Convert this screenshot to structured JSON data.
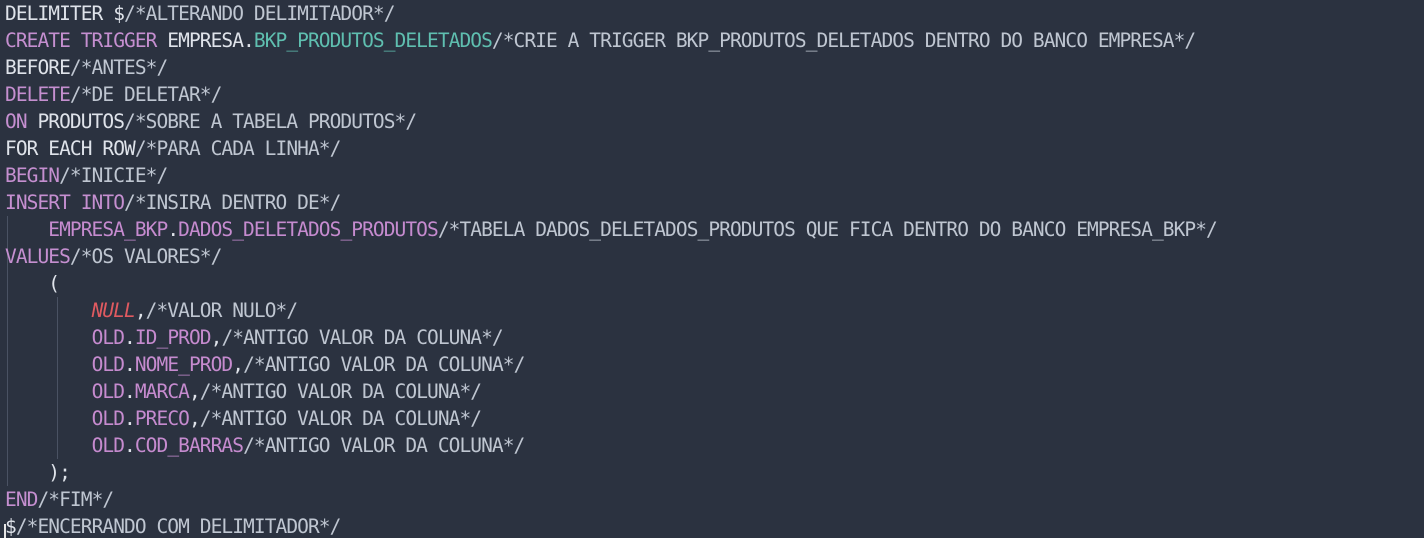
{
  "editor": {
    "colors": {
      "background": "#2b3240",
      "plain": "#dfe3ea",
      "keyword": "#c58fd0",
      "comment": "#bfc6d1",
      "identifier": "#c68bcf",
      "function": "#5fbfb0",
      "null": "#e05a60"
    },
    "lines": [
      [
        {
          "t": "plain",
          "v": "DELIMITER $"
        },
        {
          "t": "comment",
          "v": "/*ALTERANDO DELIMITADOR*/"
        }
      ],
      [
        {
          "t": "keyword",
          "v": "CREATE TRIGGER"
        },
        {
          "t": "plain",
          "v": " EMPRESA."
        },
        {
          "t": "func",
          "v": "BKP_PRODUTOS_DELETADOS"
        },
        {
          "t": "comment",
          "v": "/*CRIE A TRIGGER BKP_PRODUTOS_DELETADOS DENTRO DO BANCO EMPRESA*/"
        }
      ],
      [
        {
          "t": "plain",
          "v": "BEFORE"
        },
        {
          "t": "comment",
          "v": "/*ANTES*/"
        }
      ],
      [
        {
          "t": "keyword",
          "v": "DELETE"
        },
        {
          "t": "comment",
          "v": "/*DE DELETAR*/"
        }
      ],
      [
        {
          "t": "keyword",
          "v": "ON"
        },
        {
          "t": "plain",
          "v": " PRODUTOS"
        },
        {
          "t": "comment",
          "v": "/*SOBRE A TABELA PRODUTOS*/"
        }
      ],
      [
        {
          "t": "plain",
          "v": "FOR EACH ROW"
        },
        {
          "t": "comment",
          "v": "/*PARA CADA LINHA*/"
        }
      ],
      [
        {
          "t": "keyword",
          "v": "BEGIN"
        },
        {
          "t": "comment",
          "v": "/*INICIE*/"
        }
      ],
      [
        {
          "t": "keyword",
          "v": "INSERT INTO"
        },
        {
          "t": "comment",
          "v": "/*INSIRA DENTRO DE*/"
        }
      ],
      [
        {
          "t": "plain",
          "v": "    "
        },
        {
          "t": "ident",
          "v": "EMPRESA_BKP"
        },
        {
          "t": "plain",
          "v": "."
        },
        {
          "t": "ident",
          "v": "DADOS_DELETADOS_PRODUTOS"
        },
        {
          "t": "comment",
          "v": "/*TABELA DADOS_DELETADOS_PRODUTOS QUE FICA DENTRO DO BANCO EMPRESA_BKP*/"
        }
      ],
      [
        {
          "t": "keyword",
          "v": "VALUES"
        },
        {
          "t": "comment",
          "v": "/*OS VALORES*/"
        }
      ],
      [
        {
          "t": "plain",
          "v": "    ("
        }
      ],
      [
        {
          "t": "plain",
          "v": "        "
        },
        {
          "t": "null",
          "v": "NULL"
        },
        {
          "t": "plain",
          "v": ","
        },
        {
          "t": "comment",
          "v": "/*VALOR NULO*/"
        }
      ],
      [
        {
          "t": "plain",
          "v": "        "
        },
        {
          "t": "ident",
          "v": "OLD"
        },
        {
          "t": "plain",
          "v": "."
        },
        {
          "t": "ident",
          "v": "ID_PROD"
        },
        {
          "t": "plain",
          "v": ","
        },
        {
          "t": "comment",
          "v": "/*ANTIGO VALOR DA COLUNA*/"
        }
      ],
      [
        {
          "t": "plain",
          "v": "        "
        },
        {
          "t": "ident",
          "v": "OLD"
        },
        {
          "t": "plain",
          "v": "."
        },
        {
          "t": "ident",
          "v": "NOME_PROD"
        },
        {
          "t": "plain",
          "v": ","
        },
        {
          "t": "comment",
          "v": "/*ANTIGO VALOR DA COLUNA*/"
        }
      ],
      [
        {
          "t": "plain",
          "v": "        "
        },
        {
          "t": "ident",
          "v": "OLD"
        },
        {
          "t": "plain",
          "v": "."
        },
        {
          "t": "ident",
          "v": "MARCA"
        },
        {
          "t": "plain",
          "v": ","
        },
        {
          "t": "comment",
          "v": "/*ANTIGO VALOR DA COLUNA*/"
        }
      ],
      [
        {
          "t": "plain",
          "v": "        "
        },
        {
          "t": "ident",
          "v": "OLD"
        },
        {
          "t": "plain",
          "v": "."
        },
        {
          "t": "ident",
          "v": "PRECO"
        },
        {
          "t": "plain",
          "v": ","
        },
        {
          "t": "comment",
          "v": "/*ANTIGO VALOR DA COLUNA*/"
        }
      ],
      [
        {
          "t": "plain",
          "v": "        "
        },
        {
          "t": "ident",
          "v": "OLD"
        },
        {
          "t": "plain",
          "v": "."
        },
        {
          "t": "ident",
          "v": "COD_BARRAS"
        },
        {
          "t": "comment",
          "v": "/*ANTIGO VALOR DA COLUNA*/"
        }
      ],
      [
        {
          "t": "plain",
          "v": "    );"
        }
      ],
      [
        {
          "t": "keyword",
          "v": "END"
        },
        {
          "t": "comment",
          "v": "/*FIM*/"
        }
      ],
      [
        {
          "t": "plain",
          "v": "$"
        },
        {
          "t": "comment",
          "v": "/*ENCERRANDO COM DELIMITADOR*/"
        }
      ]
    ]
  }
}
